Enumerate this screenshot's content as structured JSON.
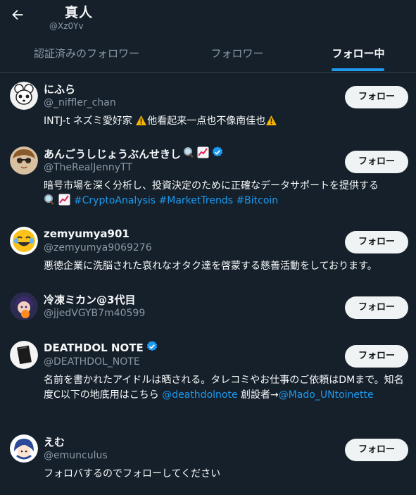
{
  "header": {
    "title": "真人",
    "handle": "@Xz0Yv"
  },
  "tabs": [
    {
      "label": "認証済みのフォロワー"
    },
    {
      "label": "フォロワー"
    },
    {
      "label": "フォロー中"
    }
  ],
  "follow_label": "フォロー",
  "colors": {
    "background": "#15202b",
    "accent": "#1d9bf0",
    "secondary_text": "#8b98a5"
  },
  "users": [
    {
      "name": "にふら",
      "handle": "@_niffler_chan",
      "bio_a": "INTJ-t ネズミ愛好家 ",
      "bio_b": "他看起来一点也不像南佳也"
    },
    {
      "name": "あんごうしじょうぶんせきし",
      "handle": "@TheRealJennyTT",
      "bio_text": "暗号市場を深く分析し、投資決定のために正確なデータサポートを提供する",
      "hashtags": "#CryptoAnalysis #MarketTrends #Bitcoin"
    },
    {
      "name": "zemyumya901",
      "handle": "@zemyumya9069276",
      "bio": "悪徳企業に洗脳された哀れなオタク達を啓蒙する慈善活動をしております。"
    },
    {
      "name": "冷凍ミカン@3代目",
      "handle": "@jjedVGYB7m40599"
    },
    {
      "name": "DEATHDOL NOTE",
      "handle": "@DEATHDOL_NOTE",
      "bio_a": "名前を書かれたアイドルは晒される。タレコミやお仕事のご依頼はDMまで。知名度C以下の地底用はこちら ",
      "bio_link1": "@deathdolnote",
      "bio_b": " 創設者→",
      "bio_link2": "@Mado_UNtoinette"
    },
    {
      "name": "えむ",
      "handle": "@emunculus",
      "bio": "フォロバするのでフォローしてください"
    }
  ]
}
